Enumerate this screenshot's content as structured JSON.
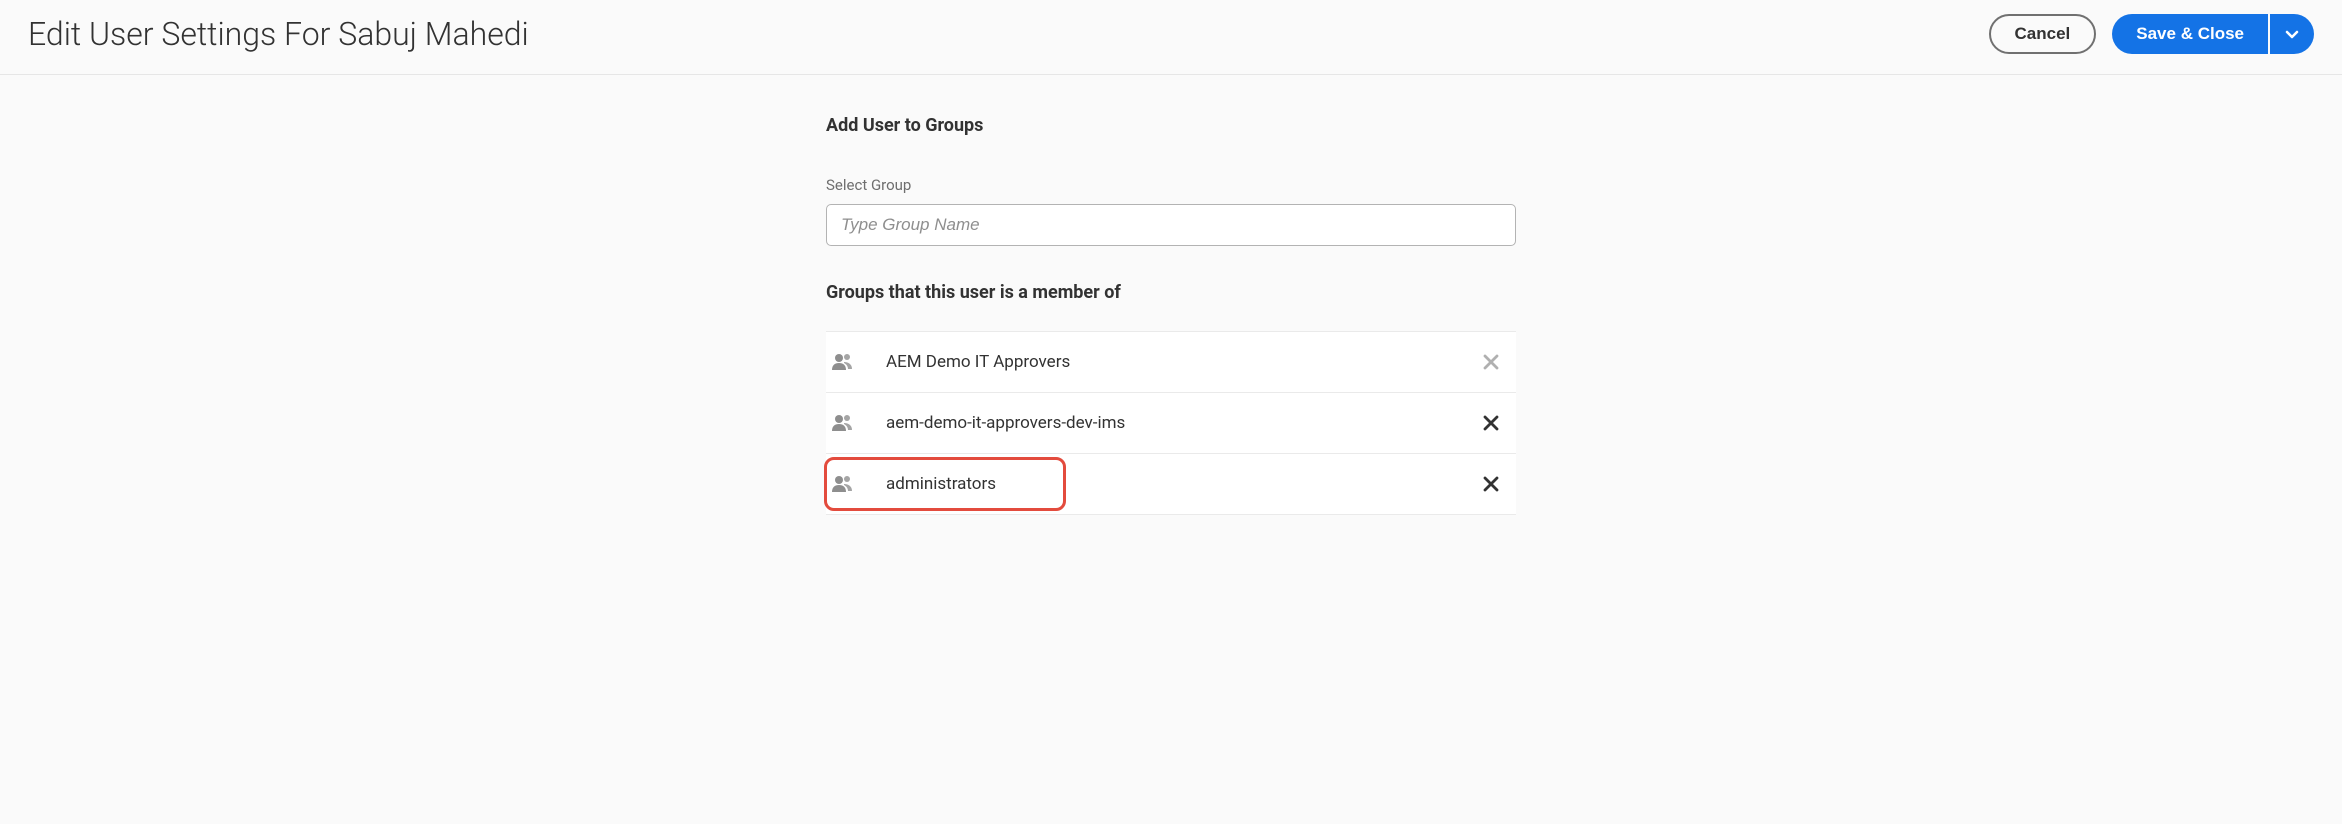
{
  "header": {
    "title": "Edit User Settings For Sabuj Mahedi",
    "cancel_label": "Cancel",
    "save_label": "Save & Close"
  },
  "form": {
    "add_heading": "Add User to Groups",
    "select_label": "Select Group",
    "group_placeholder": "Type Group Name",
    "member_heading": "Groups that this user is a member of",
    "groups": [
      {
        "name": "AEM Demo IT Approvers",
        "remove_muted": true,
        "highlighted": false
      },
      {
        "name": "aem-demo-it-approvers-dev-ims",
        "remove_muted": false,
        "highlighted": false
      },
      {
        "name": "administrators",
        "remove_muted": false,
        "highlighted": true
      }
    ]
  }
}
